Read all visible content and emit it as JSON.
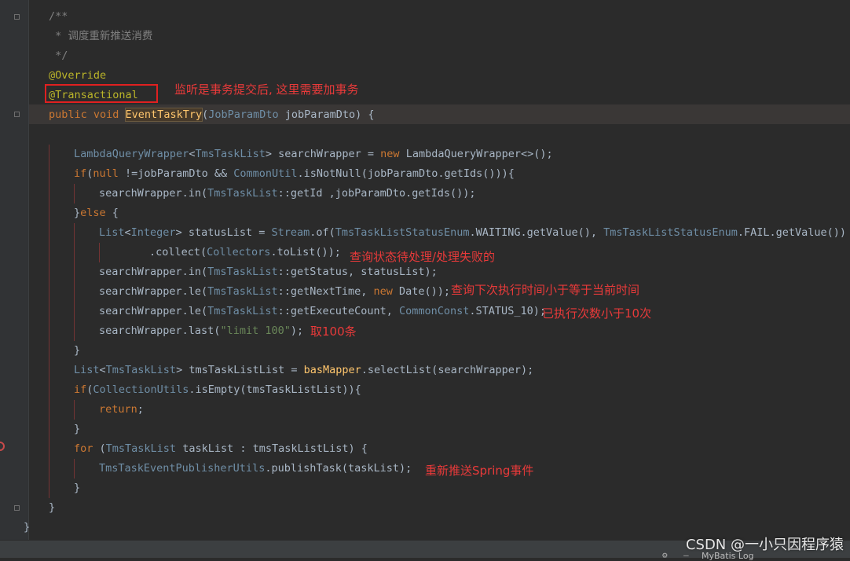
{
  "editor": {
    "lines": [
      {
        "indent": 62,
        "parts": [
          {
            "c": "c-comment",
            "t": "/**"
          }
        ]
      },
      {
        "indent": 62,
        "parts": [
          {
            "c": "c-comment",
            "t": " * 调度重新推送消费"
          }
        ]
      },
      {
        "indent": 62,
        "parts": [
          {
            "c": "c-comment",
            "t": " */"
          }
        ]
      },
      {
        "indent": 62,
        "parts": [
          {
            "c": "c-ann",
            "t": "@Override"
          }
        ]
      },
      {
        "indent": 62,
        "parts": [
          {
            "c": "c-ann",
            "t": "@Transactional"
          }
        ]
      },
      {
        "indent": 62,
        "parts": [
          {
            "c": "c-kw",
            "t": "public void "
          },
          {
            "c": "c-method c-hl",
            "t": "EventTaskTry"
          },
          {
            "c": "c-plain",
            "t": "("
          },
          {
            "c": "c-type",
            "t": "JobParamDto"
          },
          {
            "c": "c-plain",
            "t": " jobParamDto) {"
          }
        ]
      },
      {
        "indent": 62,
        "parts": []
      },
      {
        "indent": 94,
        "parts": [
          {
            "c": "c-type",
            "t": "LambdaQueryWrapper"
          },
          {
            "c": "c-plain",
            "t": "<"
          },
          {
            "c": "c-type",
            "t": "TmsTaskList"
          },
          {
            "c": "c-plain",
            "t": "> searchWrapper = "
          },
          {
            "c": "c-kw",
            "t": "new "
          },
          {
            "c": "c-plain",
            "t": "LambdaQueryWrapper<>();"
          }
        ]
      },
      {
        "indent": 94,
        "parts": [
          {
            "c": "c-kw",
            "t": "if"
          },
          {
            "c": "c-plain",
            "t": "("
          },
          {
            "c": "c-kw",
            "t": "null"
          },
          {
            "c": "c-plain",
            "t": " !=jobParamDto && "
          },
          {
            "c": "c-type",
            "t": "CommonUtil"
          },
          {
            "c": "c-plain",
            "t": ".isNotNull(jobParamDto.getIds())){"
          }
        ]
      },
      {
        "indent": 126,
        "parts": [
          {
            "c": "c-plain",
            "t": "searchWrapper.in("
          },
          {
            "c": "c-type",
            "t": "TmsTaskList"
          },
          {
            "c": "c-plain",
            "t": "::getId ,jobParamDto.getIds());"
          }
        ]
      },
      {
        "indent": 94,
        "parts": [
          {
            "c": "c-plain",
            "t": "}"
          },
          {
            "c": "c-kw",
            "t": "else"
          },
          {
            "c": "c-plain",
            "t": " {"
          }
        ]
      },
      {
        "indent": 126,
        "parts": [
          {
            "c": "c-type",
            "t": "List"
          },
          {
            "c": "c-plain",
            "t": "<"
          },
          {
            "c": "c-type",
            "t": "Integer"
          },
          {
            "c": "c-plain",
            "t": "> statusList = "
          },
          {
            "c": "c-type",
            "t": "Stream"
          },
          {
            "c": "c-plain",
            "t": ".of("
          },
          {
            "c": "c-type",
            "t": "TmsTaskListStatusEnum"
          },
          {
            "c": "c-plain",
            "t": ".WAITING.getValue(), "
          },
          {
            "c": "c-type",
            "t": "TmsTaskListStatusEnum"
          },
          {
            "c": "c-plain",
            "t": ".FAIL.getValue())"
          }
        ]
      },
      {
        "indent": 190,
        "parts": [
          {
            "c": "c-plain",
            "t": ".collect("
          },
          {
            "c": "c-type",
            "t": "Collectors"
          },
          {
            "c": "c-plain",
            "t": ".toList());"
          }
        ]
      },
      {
        "indent": 126,
        "parts": [
          {
            "c": "c-plain",
            "t": "searchWrapper.in("
          },
          {
            "c": "c-type",
            "t": "TmsTaskList"
          },
          {
            "c": "c-plain",
            "t": "::getStatus, statusList);"
          }
        ]
      },
      {
        "indent": 126,
        "parts": [
          {
            "c": "c-plain",
            "t": "searchWrapper.le("
          },
          {
            "c": "c-type",
            "t": "TmsTaskList"
          },
          {
            "c": "c-plain",
            "t": "::getNextTime, "
          },
          {
            "c": "c-kw",
            "t": "new "
          },
          {
            "c": "c-plain",
            "t": "Date());"
          }
        ]
      },
      {
        "indent": 126,
        "parts": [
          {
            "c": "c-plain",
            "t": "searchWrapper.le("
          },
          {
            "c": "c-type",
            "t": "TmsTaskList"
          },
          {
            "c": "c-plain",
            "t": "::getExecuteCount, "
          },
          {
            "c": "c-type",
            "t": "CommonConst"
          },
          {
            "c": "c-plain",
            "t": ".STATUS_10);"
          }
        ]
      },
      {
        "indent": 126,
        "parts": [
          {
            "c": "c-plain",
            "t": "searchWrapper.last("
          },
          {
            "c": "c-str",
            "t": "\"limit 100\""
          },
          {
            "c": "c-plain",
            "t": ");"
          }
        ]
      },
      {
        "indent": 94,
        "parts": [
          {
            "c": "c-plain",
            "t": "}"
          }
        ]
      },
      {
        "indent": 94,
        "parts": [
          {
            "c": "c-type",
            "t": "List"
          },
          {
            "c": "c-plain",
            "t": "<"
          },
          {
            "c": "c-type",
            "t": "TmsTaskList"
          },
          {
            "c": "c-plain",
            "t": "> tmsTaskListList = "
          },
          {
            "c": "c-method",
            "t": "basMapper"
          },
          {
            "c": "c-plain",
            "t": ".selectList(searchWrapper);"
          }
        ]
      },
      {
        "indent": 94,
        "parts": [
          {
            "c": "c-kw",
            "t": "if"
          },
          {
            "c": "c-plain",
            "t": "("
          },
          {
            "c": "c-type",
            "t": "CollectionUtils"
          },
          {
            "c": "c-plain",
            "t": ".isEmpty(tmsTaskListList)){"
          }
        ]
      },
      {
        "indent": 126,
        "parts": [
          {
            "c": "c-kw",
            "t": "return"
          },
          {
            "c": "c-plain",
            "t": ";"
          }
        ]
      },
      {
        "indent": 94,
        "parts": [
          {
            "c": "c-plain",
            "t": "}"
          }
        ]
      },
      {
        "indent": 94,
        "parts": [
          {
            "c": "c-kw",
            "t": "for"
          },
          {
            "c": "c-plain",
            "t": " ("
          },
          {
            "c": "c-type",
            "t": "TmsTaskList"
          },
          {
            "c": "c-plain",
            "t": " taskList : tmsTaskListList) {"
          }
        ]
      },
      {
        "indent": 126,
        "parts": [
          {
            "c": "c-type",
            "t": "TmsTaskEventPublisherUtils"
          },
          {
            "c": "c-plain",
            "t": ".publishTask(taskList);"
          }
        ]
      },
      {
        "indent": 94,
        "parts": [
          {
            "c": "c-plain",
            "t": "}"
          }
        ]
      },
      {
        "indent": 62,
        "parts": [
          {
            "c": "c-plain",
            "t": "}"
          }
        ]
      },
      {
        "indent": 30,
        "parts": [
          {
            "c": "c-plain",
            "t": "}"
          }
        ]
      }
    ]
  },
  "annotations": {
    "transactional_note": "监听是事务提交后, 这里需要加事务",
    "status_note": "查询状态待处理/处理失败的",
    "next_time_note": "查询下次执行时间小于等于当前时间",
    "execute_count_note": "已执行次数小于10次",
    "limit_note": "取100条",
    "publish_note": "重新推送Spring事件"
  },
  "watermark": "CSDN @一小只因程序猿",
  "bottom_bar": {
    "tool_label": "MyBatis Log"
  }
}
